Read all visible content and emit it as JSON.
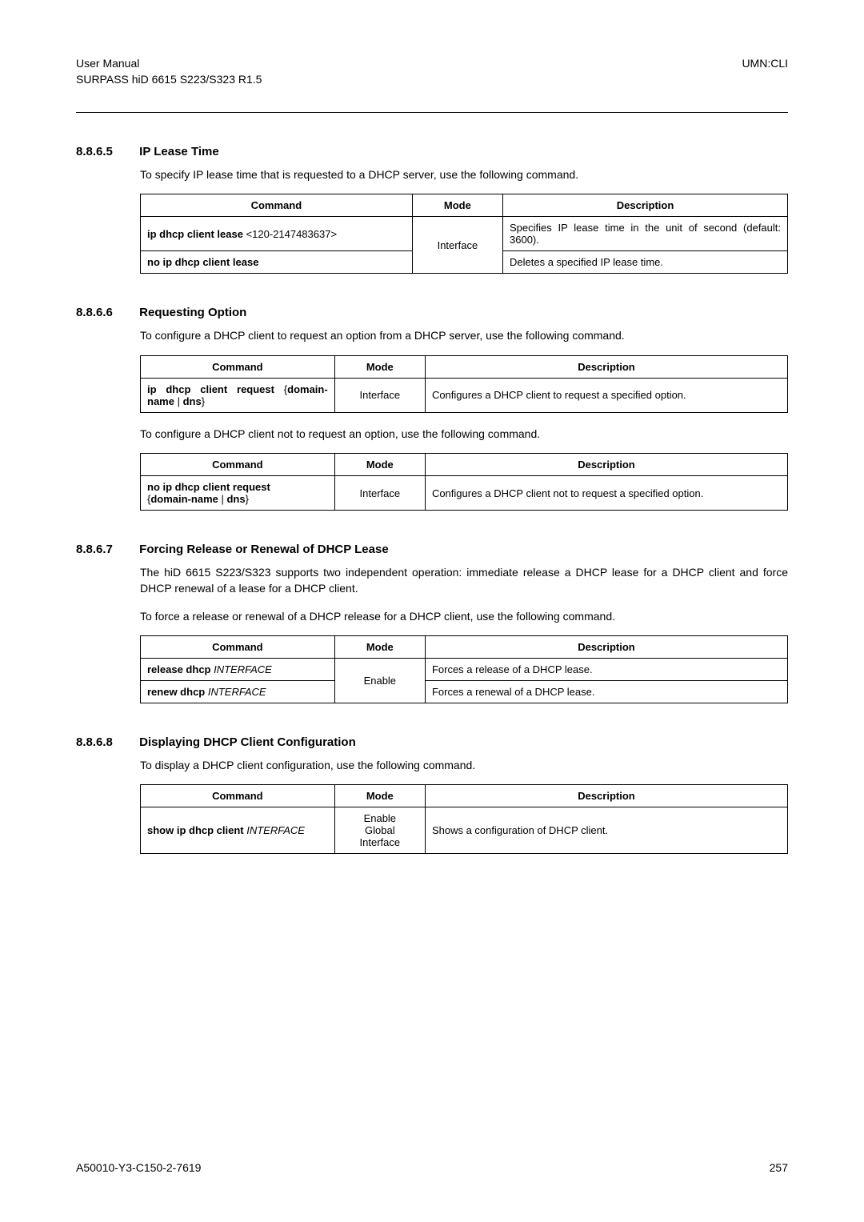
{
  "header": {
    "left1": "User Manual",
    "left2": "SURPASS hiD 6615 S223/S323 R1.5",
    "right": "UMN:CLI"
  },
  "sections": {
    "s1": {
      "num": "8.8.6.5",
      "title": "IP Lease Time",
      "p1": "To specify IP lease time that is requested to a DHCP server, use the following command.",
      "th_cmd": "Command",
      "th_mode": "Mode",
      "th_desc": "Description",
      "r1_cmd_b": "ip dhcp client lease ",
      "r1_cmd_p": "<120-2147483637>",
      "r1_desc": "Specifies IP lease time in the unit of second (default: 3600).",
      "r2_cmd": "no ip dhcp client lease",
      "r2_desc": "Deletes a specified IP lease time.",
      "mode": "Interface"
    },
    "s2": {
      "num": "8.8.6.6",
      "title": "Requesting Option",
      "p1": "To configure a DHCP client to request an option from a DHCP server, use the following command.",
      "th_cmd": "Command",
      "th_mode": "Mode",
      "th_desc": "Description",
      "r1_cmd_a": "ip dhcp client request ",
      "r1_cmd_b": "{",
      "r1_cmd_c": "domain-name",
      "r1_cmd_d": " | ",
      "r1_cmd_e": "dns",
      "r1_cmd_f": "}",
      "r1_mode": "Interface",
      "r1_desc": "Configures a DHCP client to request a specified option.",
      "p2": "To configure a DHCP client not to request an option, use the following command.",
      "r2_cmd_a": "no ip dhcp client request",
      "r2_cmd_b": "{",
      "r2_cmd_c": "domain-name",
      "r2_cmd_d": " | ",
      "r2_cmd_e": "dns",
      "r2_cmd_f": "}",
      "r2_mode": "Interface",
      "r2_desc": "Configures a DHCP client not to request a specified option."
    },
    "s3": {
      "num": "8.8.6.7",
      "title": "Forcing Release or Renewal of DHCP Lease",
      "p1": "The hiD 6615 S223/S323 supports two independent operation: immediate release a DHCP lease for a DHCP client and force DHCP renewal of a lease for a DHCP client.",
      "p2": "To force a release or renewal of a DHCP release for a DHCP client, use the following command.",
      "th_cmd": "Command",
      "th_mode": "Mode",
      "th_desc": "Description",
      "r1_cmd_b": "release dhcp ",
      "r1_cmd_i": "INTERFACE",
      "r1_desc": "Forces a release of a DHCP lease.",
      "r2_cmd_b": "renew dhcp ",
      "r2_cmd_i": "INTERFACE",
      "r2_desc": "Forces a renewal of a DHCP lease.",
      "mode": "Enable"
    },
    "s4": {
      "num": "8.8.6.8",
      "title": "Displaying DHCP Client Configuration",
      "p1": "To display a DHCP client configuration, use the following command.",
      "th_cmd": "Command",
      "th_mode": "Mode",
      "th_desc": "Description",
      "r1_cmd_b": "show ip dhcp client ",
      "r1_cmd_i": "INTERFACE",
      "r1_mode1": "Enable",
      "r1_mode2": "Global",
      "r1_mode3": "Interface",
      "r1_desc": "Shows a configuration of DHCP client."
    }
  },
  "footer": {
    "left": "A50010-Y3-C150-2-7619",
    "right": "257"
  }
}
